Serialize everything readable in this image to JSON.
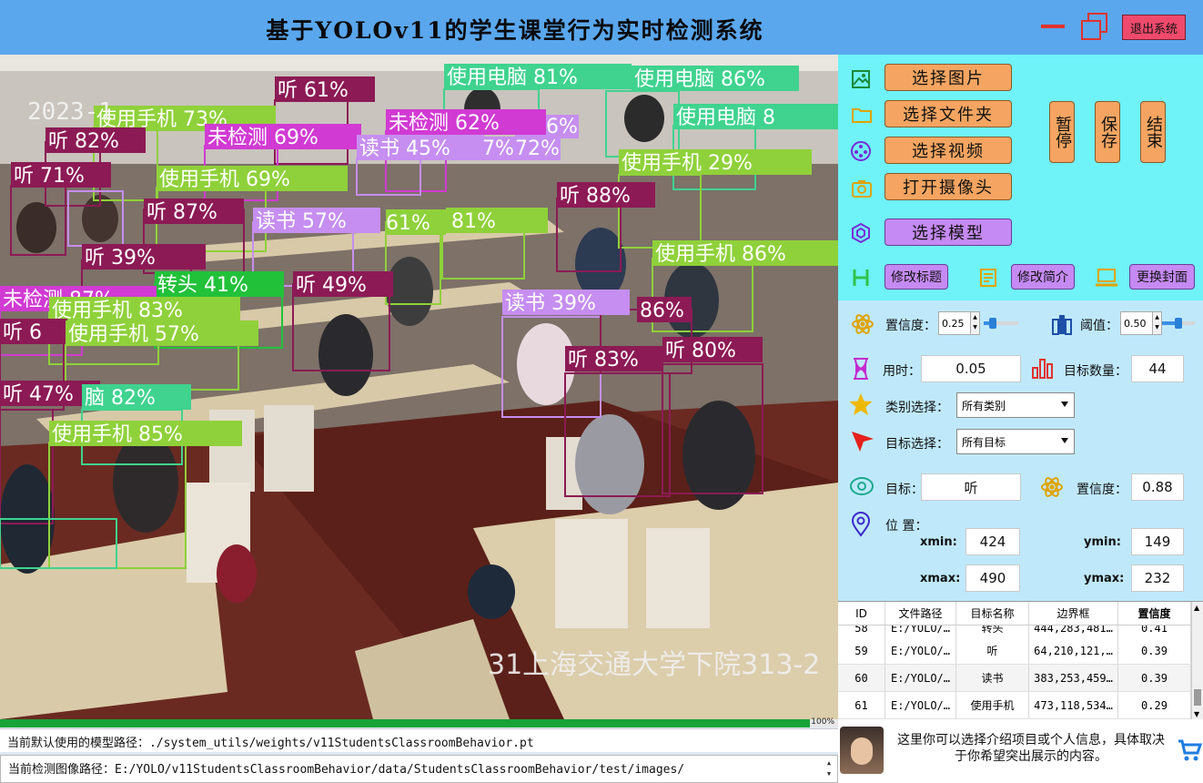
{
  "window": {
    "title": "基于YOLOv11的学生课堂行为实时检测系统",
    "exit_label": "退出系统"
  },
  "image": {
    "timestamp": "2023-1",
    "watermark": "31上海交通大学下院313-2",
    "detections": [
      {
        "label": "使用电脑 81%",
        "color": "#3fd38f"
      },
      {
        "label": "使用电脑 86%",
        "color": "#3fd38f"
      },
      {
        "label": "使用电脑 8",
        "color": "#3fd38f"
      },
      {
        "label": "听 61%",
        "color": "#8c1a55"
      },
      {
        "label": "使用手机 73%",
        "color": "#8fd13a"
      },
      {
        "label": "未检测 62%",
        "color": "#d13ad3"
      },
      {
        "label": "6%",
        "color": "#c68ef0"
      },
      {
        "label": "听 82%",
        "color": "#8c1a55"
      },
      {
        "label": "未检测 69%",
        "color": "#d13ad3"
      },
      {
        "label": "读书 45%",
        "color": "#c68ef0"
      },
      {
        "label": "7%",
        "color": "#c68ef0"
      },
      {
        "label": "72%",
        "color": "#c68ef0"
      },
      {
        "label": "使用手机 29%",
        "color": "#8fd13a"
      },
      {
        "label": "听 71%",
        "color": "#8c1a55"
      },
      {
        "label": "使用手机 69%",
        "color": "#8fd13a"
      },
      {
        "label": "听 88%",
        "color": "#8c1a55"
      },
      {
        "label": "听 87%",
        "color": "#8c1a55"
      },
      {
        "label": "读书 57%",
        "color": "#c68ef0"
      },
      {
        "label": "61%",
        "color": "#8fd13a"
      },
      {
        "label": "81%",
        "color": "#8fd13a"
      },
      {
        "label": "使用手机 86%",
        "color": "#8fd13a"
      },
      {
        "label": "听 39%",
        "color": "#8c1a55"
      },
      {
        "label": "转头 41%",
        "color": "#22c13a"
      },
      {
        "label": "听 49%",
        "color": "#8c1a55"
      },
      {
        "label": "未检测 87%",
        "color": "#d13ad3"
      },
      {
        "label": "读书 39%",
        "color": "#c68ef0"
      },
      {
        "label": "86%",
        "color": "#8c1a55"
      },
      {
        "label": "使用手机 83%",
        "color": "#8fd13a"
      },
      {
        "label": "听 6",
        "color": "#8c1a55"
      },
      {
        "label": "使用手机 57%",
        "color": "#8fd13a"
      },
      {
        "label": "听 83%",
        "color": "#8c1a55"
      },
      {
        "label": "听 80%",
        "color": "#8c1a55"
      },
      {
        "label": "听 47%",
        "color": "#8c1a55"
      },
      {
        "label": "脑 82%",
        "color": "#3fd38f"
      },
      {
        "label": "使用手机 85%",
        "color": "#8fd13a"
      }
    ]
  },
  "progress": {
    "value": 100,
    "text": "100%"
  },
  "paths": {
    "model": "当前默认使用的模型路径：./system_utils/weights/v11StudentsClassroomBehavior.pt",
    "image": "当前检测图像路径：E:/YOLO/v11StudentsClassroomBehavior/data/StudentsClassroomBehavior/test/images/"
  },
  "controls": {
    "select_image": "选择图片",
    "select_folder": "选择文件夹",
    "select_video": "选择视频",
    "open_camera": "打开摄像头",
    "select_model": "选择模型",
    "pause": "暂停",
    "save": "保存",
    "end": "结束",
    "edit_title": "修改标题",
    "edit_intro": "修改简介",
    "change_cover": "更换封面"
  },
  "params": {
    "conf_label": "置信度：",
    "conf_value": "0.25",
    "conf_slider": 0.25,
    "iou_label": "阈值：",
    "iou_value": "0.50",
    "iou_slider": 0.5,
    "time_label": "用时：",
    "time_value": "0.05",
    "count_label": "目标数量：",
    "count_value": "44",
    "class_label": "类别选择：",
    "class_value": "所有类别",
    "target_label": "目标选择：",
    "target_value": "所有目标",
    "object_label": "目标：",
    "object_value": "听",
    "obj_conf_label": "置信度：",
    "obj_conf_value": "0.88",
    "position_label": "位 置：",
    "xmin_label": "xmin:",
    "xmin_value": "424",
    "ymin_label": "ymin:",
    "ymin_value": "149",
    "xmax_label": "xmax:",
    "xmax_value": "490",
    "ymax_label": "ymax:",
    "ymax_value": "232"
  },
  "table": {
    "headers": [
      "ID",
      "文件路径",
      "目标名称",
      "边界框",
      "置信度"
    ],
    "partial_row": [
      "58",
      "E:/YOLO/…",
      "转头",
      "444,283,481…",
      "0.41"
    ],
    "rows": [
      [
        "59",
        "E:/YOLO/…",
        "听",
        "64,210,121,…",
        "0.39"
      ],
      [
        "60",
        "E:/YOLO/…",
        "读书",
        "383,253,459…",
        "0.39"
      ],
      [
        "61",
        "E:/YOLO/…",
        "使用手机",
        "473,118,534…",
        "0.29"
      ]
    ]
  },
  "info": {
    "text": "这里你可以选择介绍项目或个人信息，具体取决于你希望突出展示的内容。"
  }
}
